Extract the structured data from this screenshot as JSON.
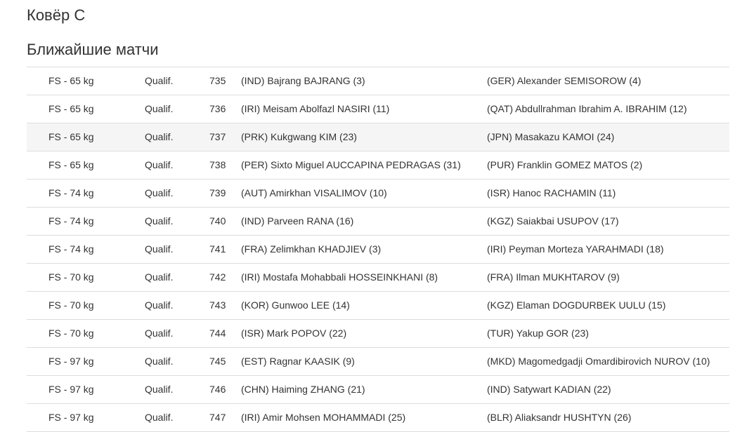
{
  "mat": {
    "title": "Ковёр C"
  },
  "upcoming": {
    "title": "Ближайшие матчи",
    "matches": [
      {
        "category": "FS - 65 kg",
        "round": "Qualif.",
        "number": "735",
        "red": "(IND) Bajrang BAJRANG (3)",
        "blue": "(GER) Alexander SEMISOROW (4)"
      },
      {
        "category": "FS - 65 kg",
        "round": "Qualif.",
        "number": "736",
        "red": "(IRI) Meisam Abolfazl NASIRI (11)",
        "blue": "(QAT) Abdullrahman Ibrahim A. IBRAHIM (12)"
      },
      {
        "category": "FS - 65 kg",
        "round": "Qualif.",
        "number": "737",
        "red": "(PRK) Kukgwang KIM (23)",
        "blue": "(JPN) Masakazu KAMOI (24)"
      },
      {
        "category": "FS - 65 kg",
        "round": "Qualif.",
        "number": "738",
        "red": "(PER) Sixto Miguel AUCCAPINA PEDRAGAS (31)",
        "blue": "(PUR) Franklin GOMEZ MATOS (2)"
      },
      {
        "category": "FS - 74 kg",
        "round": "Qualif.",
        "number": "739",
        "red": "(AUT) Amirkhan VISALIMOV (10)",
        "blue": "(ISR) Hanoc RACHAMIN (11)"
      },
      {
        "category": "FS - 74 kg",
        "round": "Qualif.",
        "number": "740",
        "red": "(IND) Parveen RANA (16)",
        "blue": "(KGZ) Saiakbai USUPOV (17)"
      },
      {
        "category": "FS - 74 kg",
        "round": "Qualif.",
        "number": "741",
        "red": "(FRA) Zelimkhan KHADJIEV (3)",
        "blue": "(IRI) Peyman Morteza YARAHMADI (18)"
      },
      {
        "category": "FS - 70 kg",
        "round": "Qualif.",
        "number": "742",
        "red": "(IRI) Mostafa Mohabbali HOSSEINKHANI (8)",
        "blue": "(FRA) Ilman MUKHTAROV (9)"
      },
      {
        "category": "FS - 70 kg",
        "round": "Qualif.",
        "number": "743",
        "red": "(KOR) Gunwoo LEE (14)",
        "blue": "(KGZ) Elaman DOGDURBEK UULU (15)"
      },
      {
        "category": "FS - 70 kg",
        "round": "Qualif.",
        "number": "744",
        "red": "(ISR) Mark POPOV (22)",
        "blue": "(TUR) Yakup GOR (23)"
      },
      {
        "category": "FS - 97 kg",
        "round": "Qualif.",
        "number": "745",
        "red": "(EST) Ragnar KAASIK (9)",
        "blue": "(MKD) Magomedgadji Omardibirovich NUROV (10)"
      },
      {
        "category": "FS - 97 kg",
        "round": "Qualif.",
        "number": "746",
        "red": "(CHN) Haiming ZHANG (21)",
        "blue": "(IND) Satywart KADIAN (22)"
      },
      {
        "category": "FS - 97 kg",
        "round": "Qualif.",
        "number": "747",
        "red": "(IRI) Amir Mohsen MOHAMMADI (25)",
        "blue": "(BLR) Aliaksandr HUSHTYN (26)"
      }
    ]
  },
  "colors": {
    "text": "#333333",
    "row_divider": "#dddddd",
    "row_hover": "#f5f5f5"
  }
}
